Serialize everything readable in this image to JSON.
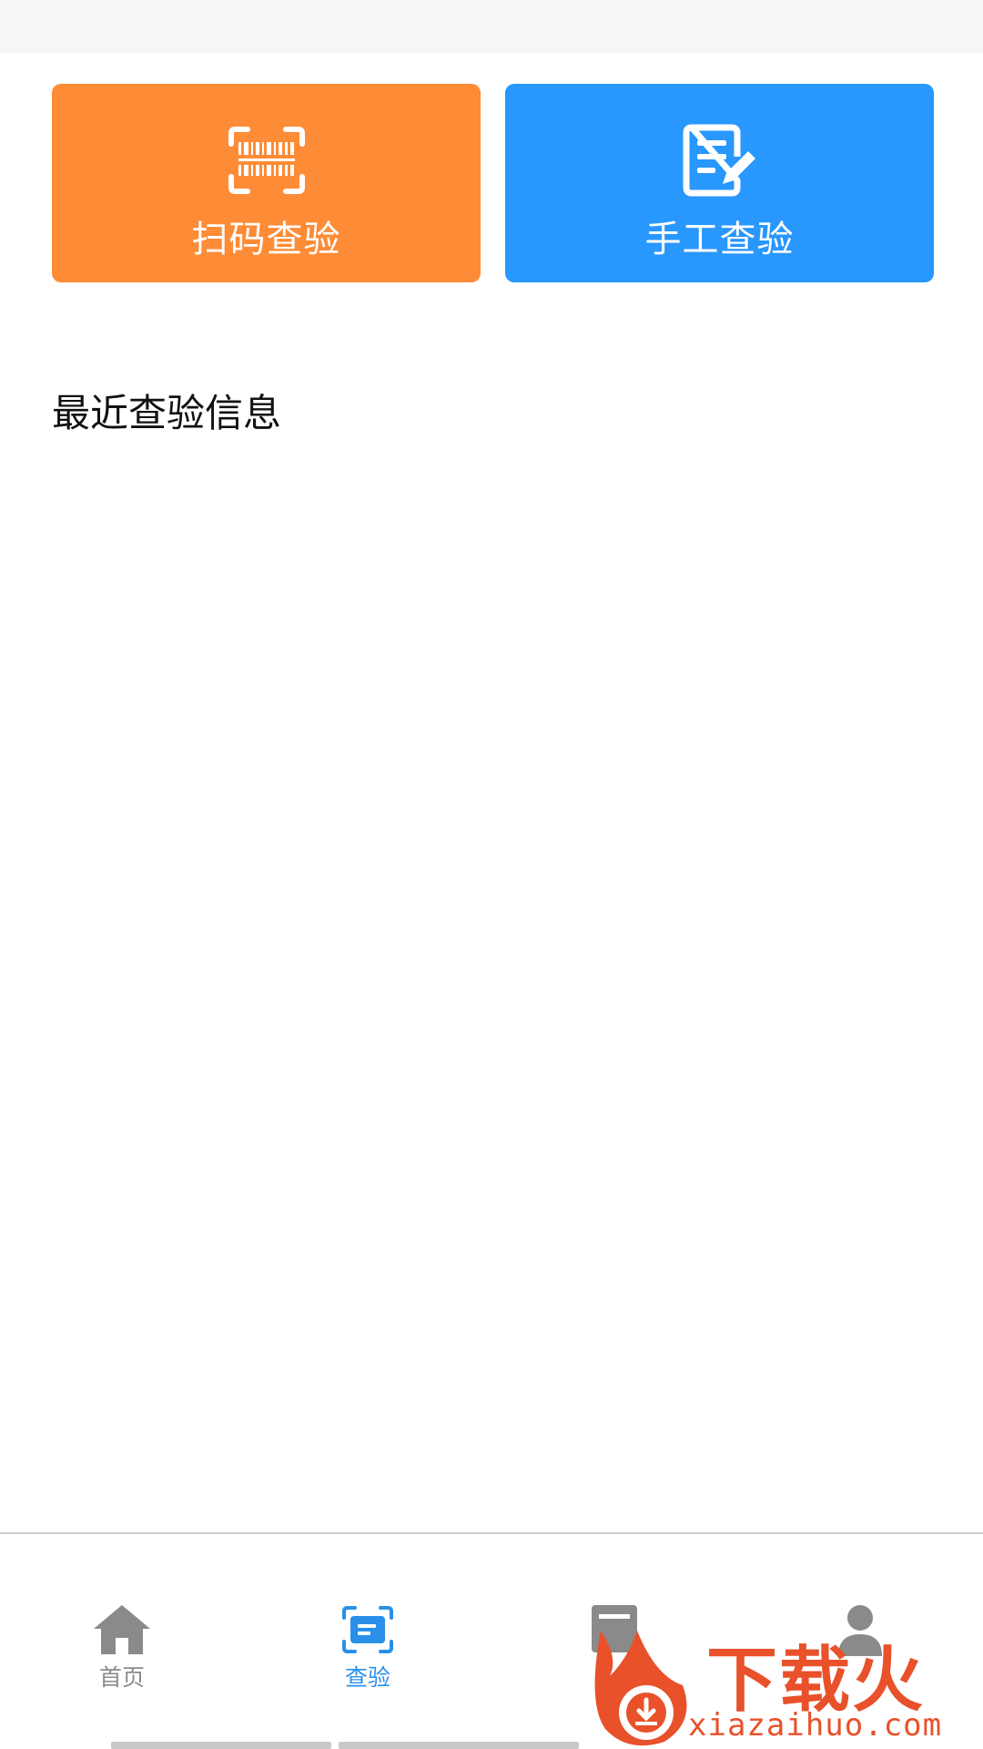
{
  "actions": {
    "scan": {
      "label": "扫码查验",
      "icon": "barcode-scan-icon",
      "color": "#fe8b35"
    },
    "manual": {
      "label": "手工查验",
      "icon": "edit-document-icon",
      "color": "#2897fe"
    }
  },
  "recent": {
    "title": "最近查验信息"
  },
  "tabbar": {
    "items": [
      {
        "label": "首页",
        "icon": "home-icon",
        "active": false
      },
      {
        "label": "查验",
        "icon": "scan-icon",
        "active": true
      },
      {
        "label": "",
        "icon": "list-icon",
        "active": false
      },
      {
        "label": "",
        "icon": "user-icon",
        "active": false
      }
    ],
    "active_color": "#2a8fe8",
    "inactive_color": "#8a8a8a"
  },
  "watermark": {
    "brand": "下载火",
    "url": "xiazaihuo.com"
  }
}
